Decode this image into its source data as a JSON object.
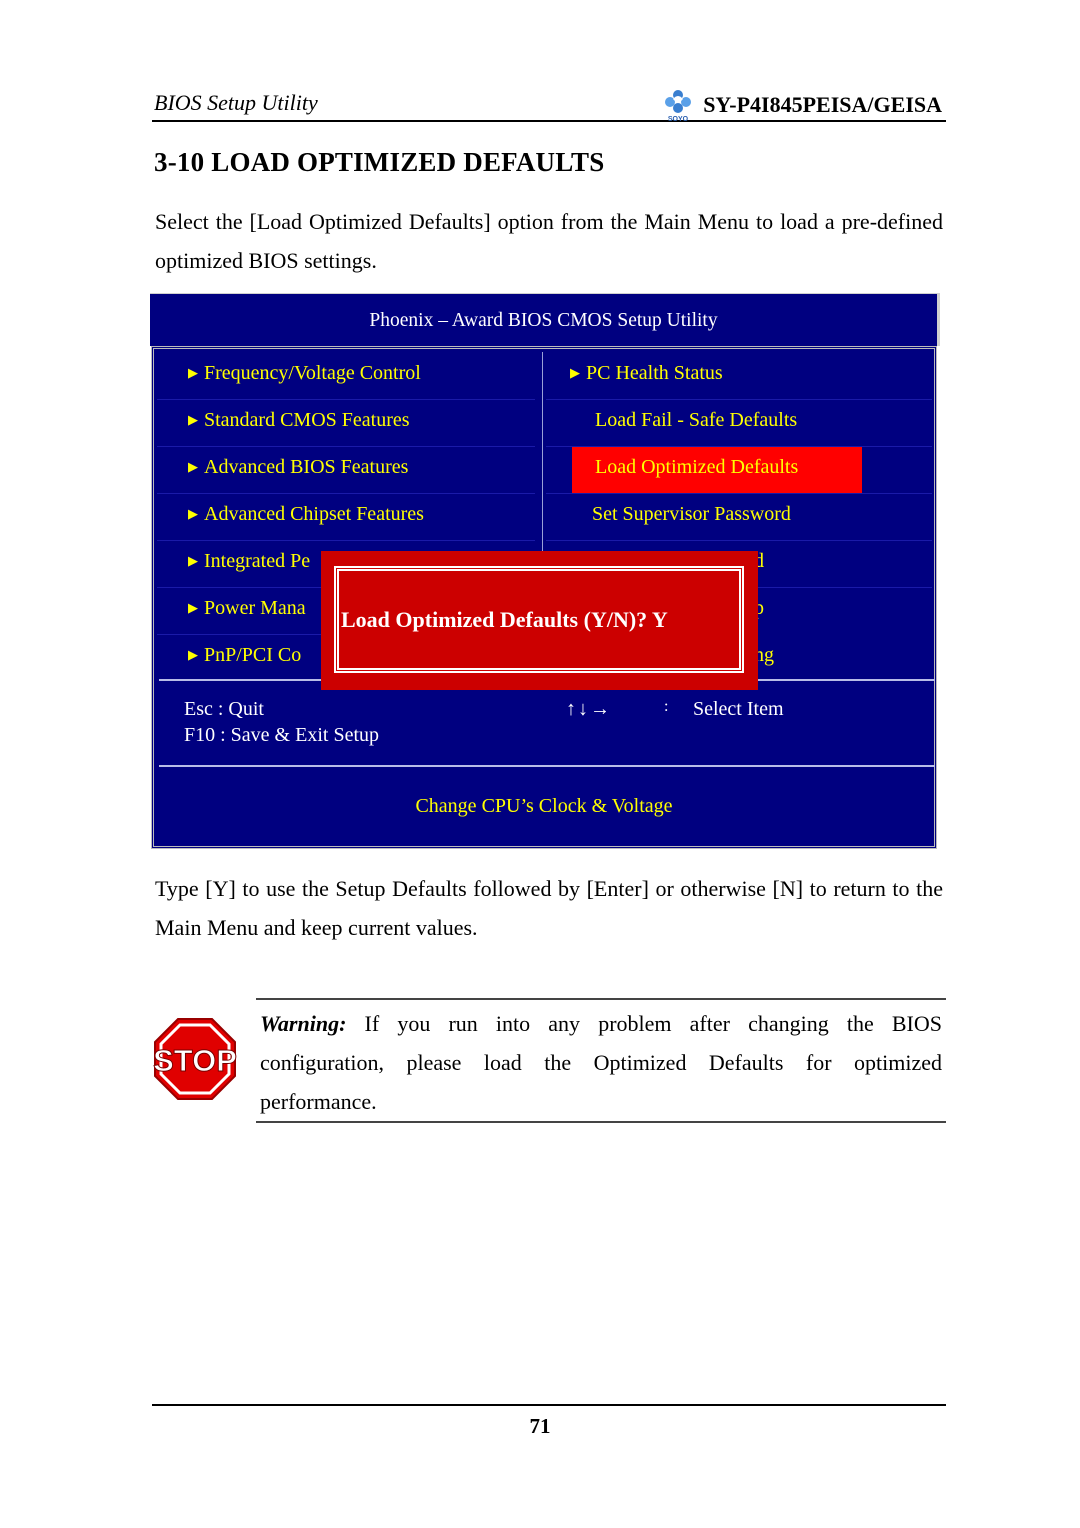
{
  "header": {
    "left_title": "BIOS Setup Utility",
    "logo_icon": "soyo-logo-icon",
    "logo_text": "SOYO",
    "model": "SY-P4I845PEISA/GEISA"
  },
  "section": {
    "heading": "3-10 LOAD OPTIMIZED DEFAULTS",
    "intro": "Select the [Load Optimized Defaults] option from the Main Menu to load a pre-defined optimized BIOS settings."
  },
  "bios_screen": {
    "title": "Phoenix – Award BIOS CMOS Setup Utility",
    "left_menu": [
      {
        "label": "Frequency/Voltage Control",
        "submenu": true
      },
      {
        "label": "Standard CMOS Features",
        "submenu": true
      },
      {
        "label": "Advanced BIOS Features",
        "submenu": true
      },
      {
        "label": "Advanced Chipset Features",
        "submenu": true
      },
      {
        "label": "Integrated Pe",
        "submenu": true
      },
      {
        "label": "Power Mana",
        "submenu": true
      },
      {
        "label": "PnP/PCI Co",
        "submenu": true
      }
    ],
    "right_menu": [
      {
        "label": "PC Health Status",
        "submenu": true
      },
      {
        "label": "Load Fail - Safe Defaults",
        "submenu": false
      },
      {
        "label": "Load Optimized Defaults",
        "submenu": false,
        "selected": true
      },
      {
        "label": "Set Supervisor Password",
        "submenu": false
      },
      {
        "label": "d",
        "submenu": false
      },
      {
        "label": "p",
        "submenu": false
      },
      {
        "label": "ng",
        "submenu": false
      }
    ],
    "arrow_glyph": "▶",
    "keys": {
      "esc": "Esc : Quit",
      "f10": "F10 : Save & Exit Setup",
      "arrows": "↑↓→",
      "colon": ":",
      "select": "Select Item"
    },
    "help_line": "Change CPU’s Clock & Voltage",
    "dialog": {
      "message": "Load Optimized Defaults (Y/N)? Y"
    },
    "colors": {
      "background": "#000080",
      "menu_text": "#ffff00",
      "highlight": "#ff0000",
      "dialog": "#cc0000"
    }
  },
  "after_text": "Type [Y] to use the Setup Defaults followed by [Enter] or otherwise [N] to return to the Main Menu and keep current values.",
  "warning": {
    "icon": "stop-sign-icon",
    "icon_text": "STOP",
    "label": "Warning:",
    "text": " If you run into any problem after changing the BIOS configuration, please load the Optimized Defaults for optimized performance."
  },
  "footer": {
    "page_number": "71"
  }
}
